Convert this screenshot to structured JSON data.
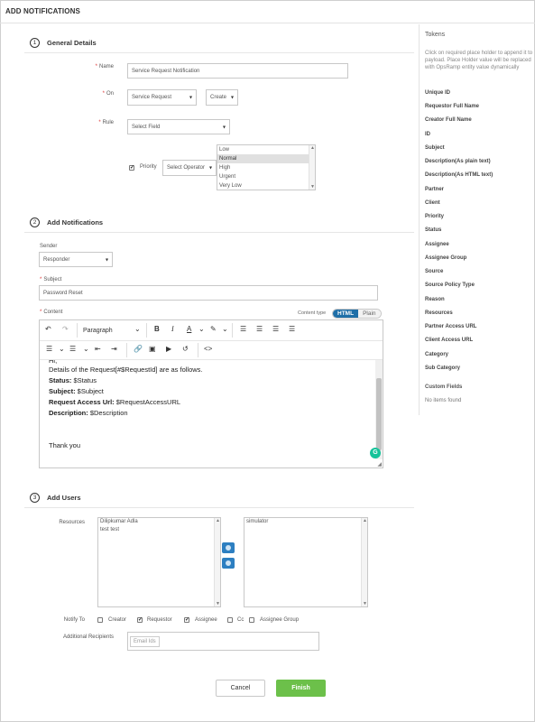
{
  "header": {
    "title": "ADD NOTIFICATIONS"
  },
  "general": {
    "number": "1",
    "title": "General Details",
    "name_label": "Name",
    "name_value": "Service Request Notification",
    "on_label": "On",
    "on_value": "Service Request",
    "on_action": "Create",
    "rule_label": "Rule",
    "rule_field": "Select Field",
    "priority_label": "Priority",
    "priority_checked": true,
    "operator": "Select Operator",
    "priority_options": [
      "Low",
      "Normal",
      "High",
      "Urgent",
      "Very Low"
    ],
    "priority_selected": "Normal"
  },
  "notifications": {
    "number": "2",
    "title": "Add Notifications",
    "sender_label": "Sender",
    "sender_value": "Responder",
    "subject_label": "Subject",
    "subject_value": "Password Reset",
    "content_label": "Content",
    "content_type_label": "Content type",
    "content_type_html": "HTML",
    "content_type_plain": "Plain",
    "block_format": "Paragraph",
    "body": {
      "cut_line": "Hi,",
      "intro": "Details of the Request[#$RequestId] are as follows.",
      "status_label": "Status:",
      "status_value": " $Status",
      "subject_label": "Subject:",
      "subject_value": " $Subject",
      "url_label": "Request Access Url:",
      "url_value": " $RequestAccessURL",
      "desc_label": "Description:",
      "desc_value": " $Description",
      "closing": "Thank you"
    }
  },
  "users": {
    "number": "3",
    "title": "Add Users",
    "resources_label": "Resources",
    "resources": [
      "Dilipkumar Adla",
      "test test"
    ],
    "selected": [
      "simulator"
    ],
    "notify_to_label": "Notify To",
    "notify_options": [
      {
        "label": "Creator",
        "checked": false
      },
      {
        "label": "Requestor",
        "checked": true
      },
      {
        "label": "Assignee",
        "checked": true
      },
      {
        "label": "Cc",
        "checked": false
      },
      {
        "label": "Assignee Group",
        "checked": false
      }
    ],
    "recipients_label": "Additional Recipients",
    "recipients_placeholder": "Email Ids"
  },
  "tokens": {
    "title": "Tokens",
    "help": "Click on required place holder to append it to payload. Place Holder value will be replaced with OpsRamp entity value dynamically",
    "items": [
      "Unique ID",
      "Requestor Full Name",
      "Creator Full Name",
      "ID",
      "Subject",
      "Description(As plain text)",
      "Description(As HTML text)",
      "Partner",
      "Client",
      "Priority",
      "Status",
      "Assignee",
      "Assignee Group",
      "Source",
      "Source Policy Type",
      "Reason",
      "Resources",
      "Partner Access URL",
      "Client Access URL",
      "Category",
      "Sub Category"
    ],
    "custom_title": "Custom Fields",
    "custom_empty": "No items found"
  },
  "actions": {
    "cancel": "Cancel",
    "finish": "Finish"
  },
  "colors": {
    "accent": "#1f6fa8",
    "finish": "#6cc04a",
    "move_button": "#2d7fc1",
    "required": "#dd3333"
  }
}
